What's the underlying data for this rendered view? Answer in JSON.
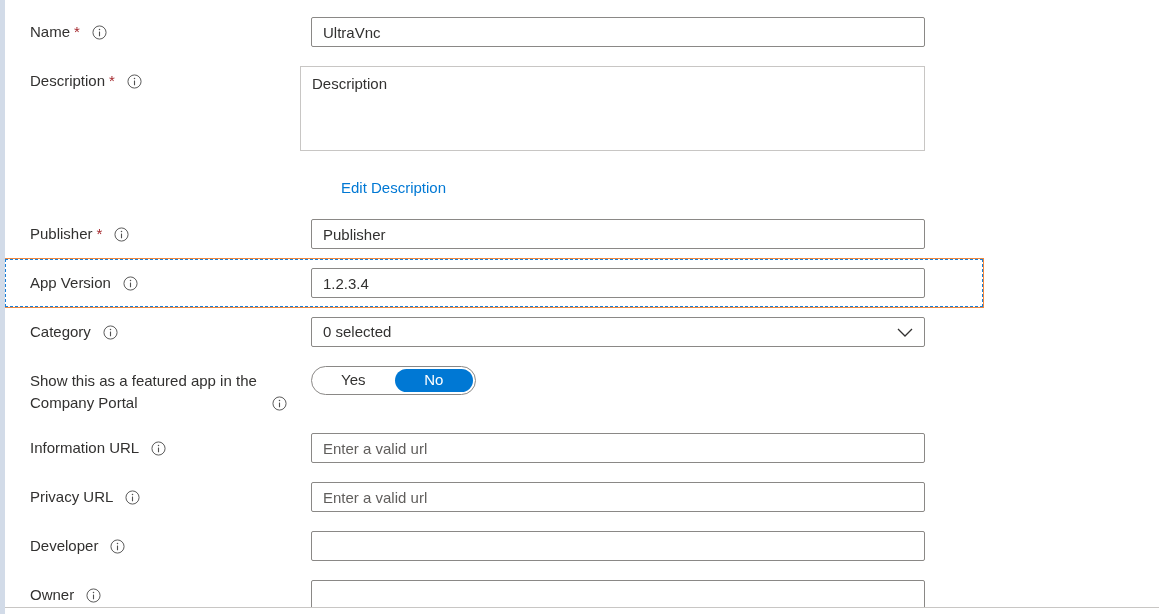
{
  "rows": [
    {
      "kind": "input",
      "label": "Name",
      "required_mark": "*",
      "value": "UltraVnc",
      "selected": false
    },
    {
      "kind": "textarea",
      "label": "Description",
      "required_mark": "*",
      "value": "Description",
      "selected": false
    },
    {
      "kind": "link",
      "text": "Edit Description"
    },
    {
      "kind": "input",
      "label": "Publisher",
      "required_mark": "*",
      "value": "Publisher",
      "selected": false
    },
    {
      "kind": "input",
      "label": "App Version",
      "value": "1.2.3.4",
      "selected": true
    },
    {
      "kind": "select",
      "label": "Category",
      "value": "0 selected",
      "selected": false
    },
    {
      "kind": "toggle",
      "label": "Show this as a featured app in the Company Portal",
      "selected": false,
      "options": [
        {
          "label": "Yes",
          "selected": false
        },
        {
          "label": "No",
          "selected": true
        }
      ]
    },
    {
      "kind": "input",
      "label": "Information URL",
      "placeholder": "Enter a valid url",
      "selected": false
    },
    {
      "kind": "input",
      "label": "Privacy URL",
      "placeholder": "Enter a valid url",
      "selected": false
    },
    {
      "kind": "input",
      "label": "Developer",
      "selected": false
    },
    {
      "kind": "input",
      "label": "Owner",
      "selected": false
    }
  ]
}
